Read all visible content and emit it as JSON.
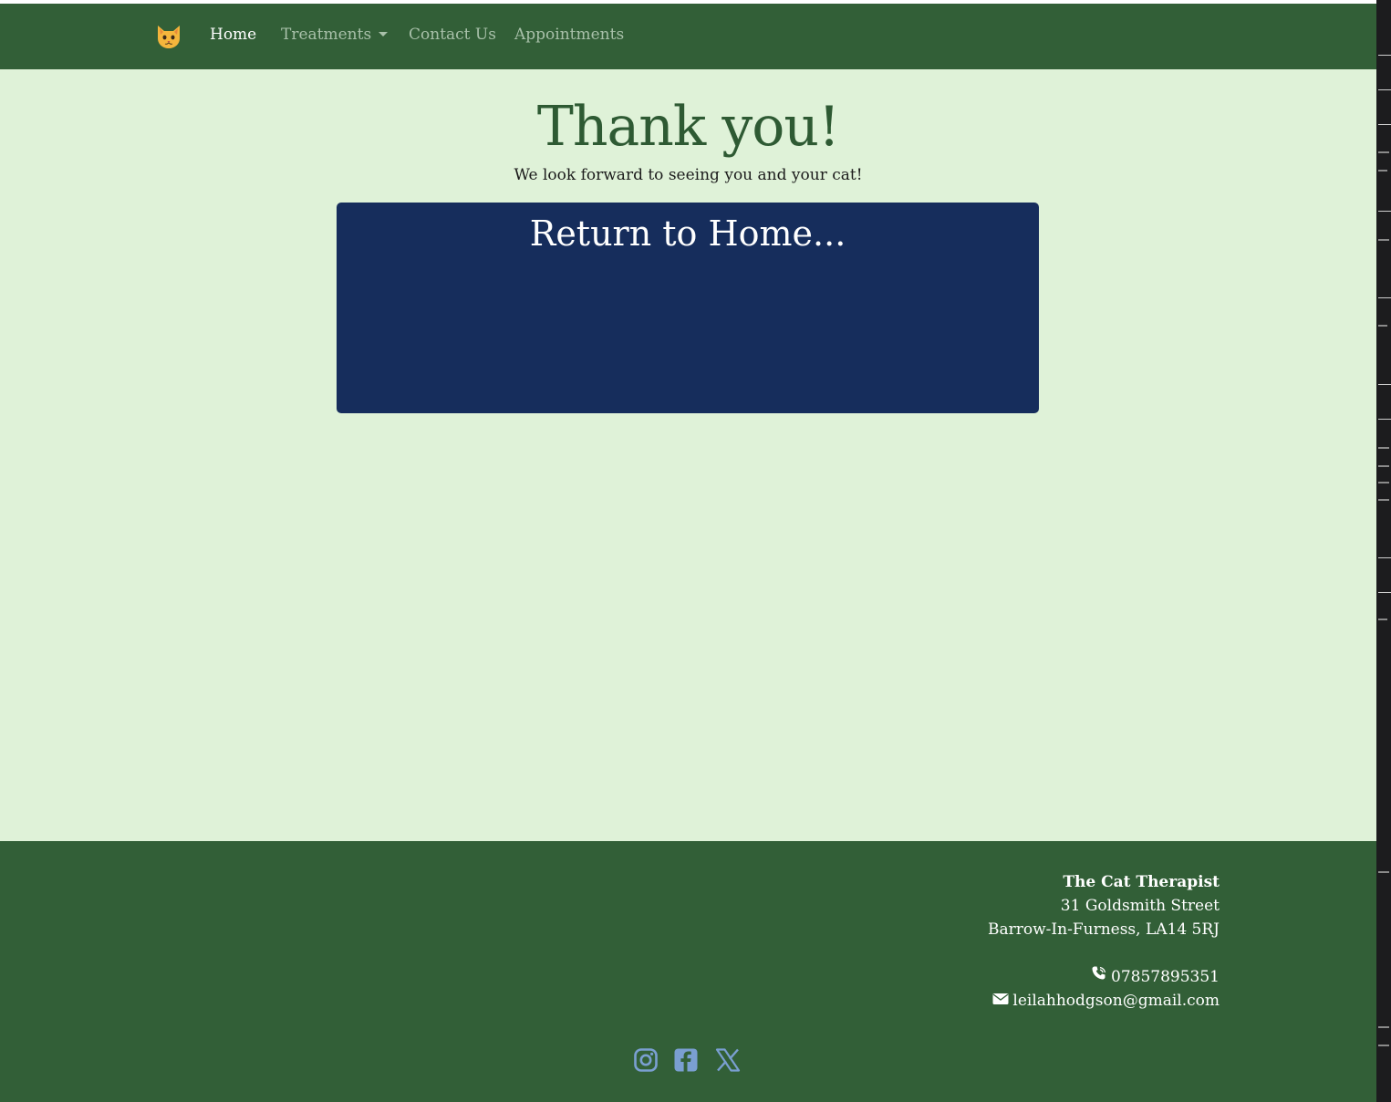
{
  "nav": {
    "brand_icon": "cat-face-icon",
    "items": [
      {
        "label": "Home",
        "active": true
      },
      {
        "label": "Treatments",
        "dropdown": true
      },
      {
        "label": "Contact Us"
      },
      {
        "label": "Appointments"
      }
    ]
  },
  "main": {
    "title": "Thank you!",
    "subtitle": "We look forward to seeing you and your cat!",
    "home_button_label": "Return to Home..."
  },
  "footer": {
    "business_name": "The Cat Therapist",
    "address_line1": "31 Goldsmith Street",
    "address_line2": "Barrow-In-Furness, LA14 5RJ",
    "phone": "07857895351",
    "email": "leilahhodgson@gmail.com",
    "socials": [
      {
        "icon": "instagram-icon"
      },
      {
        "icon": "facebook-icon"
      },
      {
        "icon": "x-twitter-icon"
      }
    ]
  },
  "colors": {
    "nav_bg": "#325f37",
    "page_bg": "#dff2d8",
    "title": "#2e5a33",
    "card_bg": "#162d5c",
    "social_icon": "#7a9fd1"
  }
}
